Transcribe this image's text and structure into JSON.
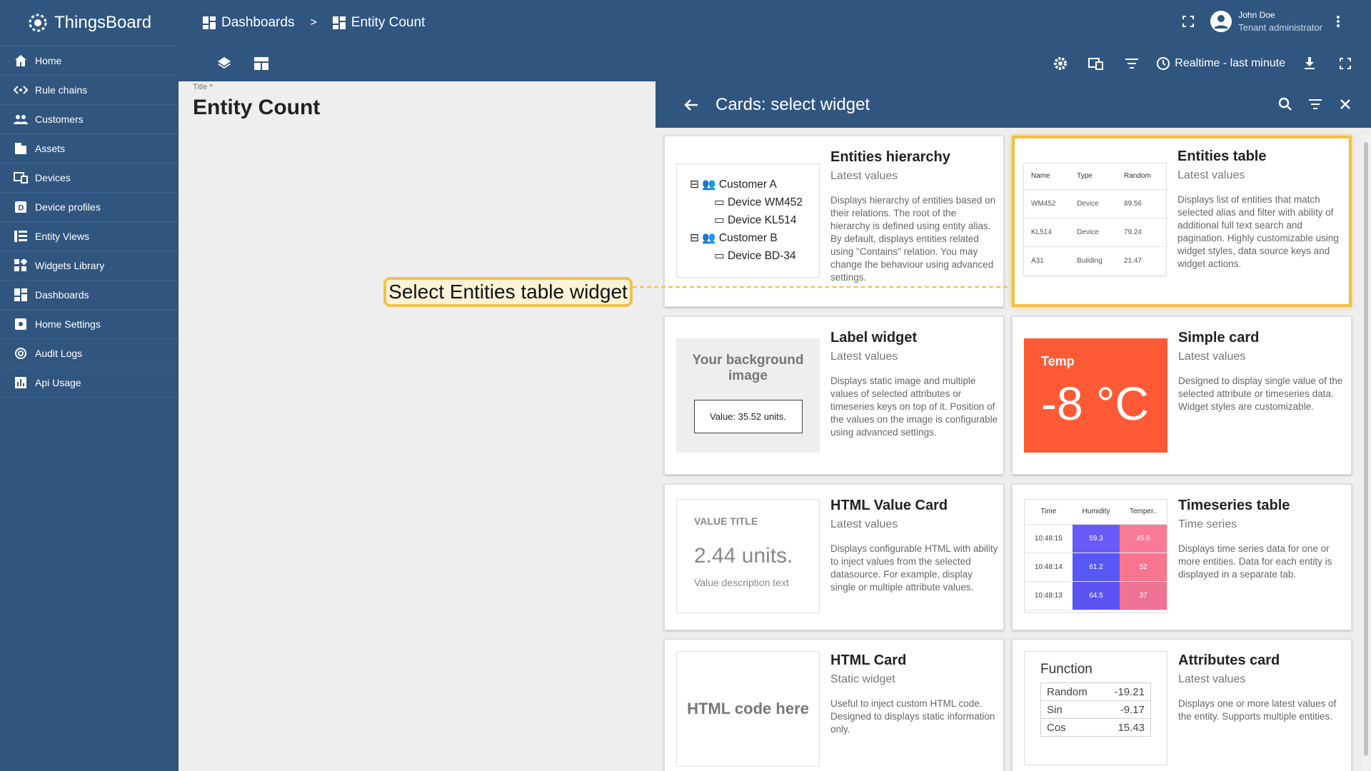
{
  "app": {
    "name": "ThingsBoard"
  },
  "sidebar": {
    "items": [
      {
        "label": "Home",
        "icon": "home-icon"
      },
      {
        "label": "Rule chains",
        "icon": "rule-chains-icon"
      },
      {
        "label": "Customers",
        "icon": "customers-icon"
      },
      {
        "label": "Assets",
        "icon": "assets-icon"
      },
      {
        "label": "Devices",
        "icon": "devices-icon"
      },
      {
        "label": "Device profiles",
        "icon": "device-profiles-icon"
      },
      {
        "label": "Entity Views",
        "icon": "entity-views-icon"
      },
      {
        "label": "Widgets Library",
        "icon": "widgets-library-icon"
      },
      {
        "label": "Dashboards",
        "icon": "dashboards-icon"
      },
      {
        "label": "Home Settings",
        "icon": "settings-icon"
      },
      {
        "label": "Audit Logs",
        "icon": "audit-logs-icon"
      },
      {
        "label": "Api Usage",
        "icon": "api-usage-icon"
      }
    ]
  },
  "header": {
    "breadcrumb": [
      "Dashboards",
      "Entity Count"
    ],
    "separator": ">",
    "user": {
      "name": "John Doe",
      "role": "Tenant administrator"
    },
    "timewindow": "Realtime - last minute"
  },
  "editor": {
    "title_label": "Title *",
    "title_value": "Entity Count"
  },
  "callout": "Select Entities table widget",
  "panel": {
    "title": "Cards: select widget",
    "cards": [
      {
        "title": "Entities hierarchy",
        "type": "Latest values",
        "desc": "Displays hierarchy of entities based on their relations. The root of the hierarchy is defined using entity alias. By default, displays entities related using \"Contains\" relation. You may change the behaviour using advanced settings."
      },
      {
        "title": "Entities table",
        "type": "Latest values",
        "desc": "Displays list of entities that match selected alias and filter with ability of additional full text search and pagination. Highly customizable using widget styles, data source keys and widget actions."
      },
      {
        "title": "Label widget",
        "type": "Latest values",
        "desc": "Displays static image and multiple values of selected attributes or timeseries keys on top of it. Position of the values on the image is configurable using advanced settings."
      },
      {
        "title": "Simple card",
        "type": "Latest values",
        "desc": "Designed to display single value of the selected attribute or timeseries data. Widget styles are customizable."
      },
      {
        "title": "HTML Value Card",
        "type": "Latest values",
        "desc": "Displays configurable HTML with ability to inject values from the selected datasource. For example, display single or multiple attribute values."
      },
      {
        "title": "Timeseries table",
        "type": "Time series",
        "desc": "Displays time series data for one or more entities. Data for each entity is displayed in a separate tab."
      },
      {
        "title": "HTML Card",
        "type": "Static widget",
        "desc": "Useful to inject custom HTML code. Designed to displays static information only."
      },
      {
        "title": "Attributes card",
        "type": "Latest values",
        "desc": "Displays one or more latest values of the entity. Supports multiple entities."
      }
    ]
  },
  "previews": {
    "hierarchy": {
      "customer_a": "Customer A",
      "dev1": "Device WM452",
      "dev2": "Device KL514",
      "customer_b": "Customer B",
      "dev3": "Device BD-34"
    },
    "entities_table": {
      "headers": [
        "Name",
        "Type",
        "Random"
      ],
      "rows": [
        [
          "WM452",
          "Device",
          "89.56"
        ],
        [
          "KL514",
          "Device",
          "79.24"
        ],
        [
          "A31",
          "Building",
          "21.47"
        ]
      ]
    },
    "label": {
      "bg_text": "Your background image",
      "value": "Value: 35.52 units."
    },
    "simple": {
      "label": "Temp",
      "value": "-8 °C",
      "color": "#ff5a36"
    },
    "html_value": {
      "title": "VALUE TITLE",
      "value": "2.44 units.",
      "desc": "Value description text"
    },
    "timeseries": {
      "headers": [
        "Time",
        "Humidity",
        "Temper.."
      ],
      "rows": [
        [
          "10:48:15",
          "59.3",
          "45.6"
        ],
        [
          "10:48:14",
          "61.2",
          "52"
        ],
        [
          "10:48:13",
          "64.5",
          "37"
        ]
      ],
      "colors": {
        "humidity": [
          "#6a5af9",
          "#5757f5",
          "#5b53f2"
        ],
        "temperature": [
          "#f97a96",
          "#f7758f",
          "#ef7395"
        ]
      }
    },
    "html_card": {
      "text": "HTML code here"
    },
    "attributes": {
      "heading": "Function",
      "rows": [
        [
          "Random",
          "-19.21"
        ],
        [
          "Sin",
          "-9.17"
        ],
        [
          "Cos",
          "15.43"
        ]
      ]
    }
  },
  "colors": {
    "primary": "#305680",
    "highlight": "#f3bf44"
  }
}
